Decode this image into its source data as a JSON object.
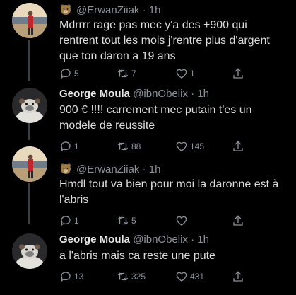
{
  "tweets": [
    {
      "name": "",
      "handle": "@ErwanZiiak",
      "time": "1h",
      "text": "Mdrrrr rage pas mec y'a des +900 qui rentrent tout les mois j'rentre plus d'argent que ton daron a 19 ans",
      "replies": "5",
      "retweets": "7",
      "likes": "1",
      "avatar": "man-red-shirt-beach-sunset"
    },
    {
      "name": "George Moula",
      "handle": "@ibnObelix",
      "time": "1h",
      "text": "900 € !!!! carrement mec putain t'es un modele de reussite",
      "replies": "1",
      "retweets": "88",
      "likes": "145",
      "avatar": "bulldog-dog"
    },
    {
      "name": "",
      "handle": "@ErwanZiiak",
      "time": "1h",
      "text": "Hmdl tout va bien pour moi la daronne est à l'abris",
      "replies": "1",
      "retweets": "5",
      "likes": "",
      "avatar": "man-red-shirt-beach-sunset"
    },
    {
      "name": "George Moula",
      "handle": "@ibnObelix",
      "time": "1h",
      "text": "a l'abris mais ca reste une pute",
      "replies": "13",
      "retweets": "325",
      "likes": "431",
      "avatar": "bulldog-dog"
    }
  ],
  "colors": {
    "background": "#000000",
    "text": "#dcdcdc",
    "muted": "#8a9199",
    "thread_line": "#3a3f44"
  }
}
